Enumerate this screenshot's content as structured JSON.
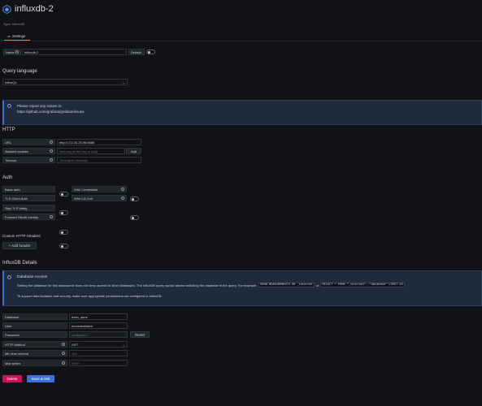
{
  "header": {
    "title": "influxdb-2",
    "type_line": "Type: InfluxDB",
    "tab_label": "Settings"
  },
  "name_row": {
    "label": "Name",
    "value": "influxdb-2",
    "default_label": "Default"
  },
  "query_language": {
    "heading": "Query language",
    "selected": "InfluxQL"
  },
  "report_alert": {
    "line1": "Please report any issues to:",
    "line2": "https://github.com/grafana/grafana/issues"
  },
  "http": {
    "heading": "HTTP",
    "url_label": "URL",
    "url_value": "http://172.20.20.98:8086",
    "cookies_label": "Allowed cookies",
    "cookies_placeholder": "New tag (enter key to add)",
    "cookies_add": "Add",
    "timeout_label": "Timeout",
    "timeout_placeholder": "Timeout in seconds"
  },
  "auth": {
    "heading": "Auth",
    "basic_auth": "Basic auth",
    "with_credentials": "With Credentials",
    "tls_client_auth": "TLS Client Auth",
    "with_ca_cert": "With CA Cert",
    "skip_tls": "Skip TLS Verify",
    "forward_oauth": "Forward OAuth Identity"
  },
  "custom_headers": {
    "heading": "Custom HTTP Headers",
    "add_button": "+ Add header"
  },
  "influx_details": {
    "heading": "InfluxDB Details",
    "alert_title": "Database Access",
    "alert_text1": "Setting the database for this datasource does not deny access to other databases. The InfluxDB query syntax allows switching the database in the query. For example:",
    "code1": "SHOW MEASUREMENTS ON _internal",
    "or_text": "or",
    "code2": "SELECT * FROM \"_internal\"..\"database\" LIMIT 10",
    "alert_text2": "To support data isolation and security, make sure appropriate permissions are configured in InfluxDB.",
    "database_label": "Database",
    "database_value": "baza_dane",
    "user_label": "User",
    "user_value": "homeassistant",
    "password_label": "Password",
    "password_value": "configured",
    "reset_label": "Reset",
    "http_method_label": "HTTP Method",
    "http_method_value": "GET",
    "min_interval_label": "Min time interval",
    "min_interval_placeholder": "10s",
    "max_series_label": "Max series",
    "max_series_placeholder": "1000"
  },
  "actions": {
    "delete": "Delete",
    "save": "Save & test"
  }
}
